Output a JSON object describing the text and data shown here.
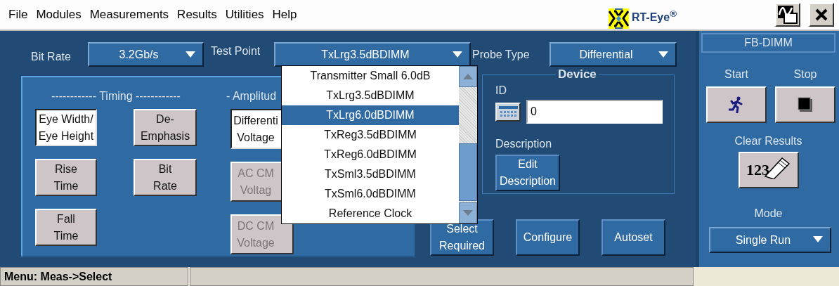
{
  "menu": [
    {
      "label": "File"
    },
    {
      "label": "Modules"
    },
    {
      "label": "Measurements"
    },
    {
      "label": "Results"
    },
    {
      "label": "Utilities"
    },
    {
      "label": "Help"
    }
  ],
  "app_title": "RT-Eye$^{®}$",
  "settings": [
    {
      "label": "Bit Rate",
      "value": "3.2Gb/s"
    },
    {
      "label": "Test Point",
      "value": "TxLrg3.5dBDIMM",
      "expanded": true
    },
    {
      "label": "Probe Type",
      "value": "Differential"
    }
  ],
  "test_point_list": [
    {
      "label": "Transmitter Small 6.0dB",
      "selected": false
    },
    {
      "label": "TxLrg3.5dBDIMM",
      "selected": false
    },
    {
      "label": "TxLrg6.0dBDIMM",
      "selected": true
    },
    {
      "label": "TxReg3.5dBDIMM",
      "selected": false
    },
    {
      "label": "TxReg6.0dBDIMM",
      "selected": false
    },
    {
      "label": "TxSml3.5dBDIMM",
      "selected": false
    },
    {
      "label": "TxSml6.0dBDIMM",
      "selected": false
    },
    {
      "label": "Reference Clock",
      "selected": false
    }
  ],
  "measurements": {
    "timing_header": "------------ Timing ------------",
    "amplitude_header": "- Amplitud",
    "timing_buttons": [
      {
        "lines": [
          "Eye Width/",
          "Eye Height"
        ],
        "selected": true,
        "disabled": false
      },
      {
        "lines": [
          "De-",
          "Emphasis"
        ],
        "selected": false,
        "disabled": false
      },
      {
        "lines": [
          "Rise",
          "Time"
        ],
        "selected": false,
        "disabled": false
      },
      {
        "lines": [
          "Bit",
          "Rate"
        ],
        "selected": false,
        "disabled": false
      },
      {
        "lines": [
          "Fall",
          "Time"
        ],
        "selected": false,
        "disabled": false
      }
    ],
    "amplitude_buttons": [
      {
        "lines": [
          "Differenti",
          "Voltage"
        ],
        "selected": true,
        "disabled": false
      },
      {
        "lines": [
          "AC CM",
          "Voltag"
        ],
        "selected": false,
        "disabled": true
      },
      {
        "lines": [
          "DC CM",
          "Voltage"
        ],
        "selected": false,
        "disabled": true
      }
    ]
  },
  "device": {
    "title": "Device",
    "id_label": "ID",
    "id_value": "0",
    "description_label": "Description",
    "edit_button": [
      "Edit",
      "Description"
    ]
  },
  "actions": [
    {
      "lines": [
        "Select",
        "Required"
      ]
    },
    {
      "lines": [
        "Configure"
      ]
    },
    {
      "lines": [
        "Autoset"
      ]
    }
  ],
  "side_panel": {
    "module": "FB-DIMM",
    "start_label": "Start",
    "stop_label": "Stop",
    "clear_label": "Clear Results",
    "clear_icon_text": "123",
    "mode_label": "Mode",
    "mode_value": "Single Run"
  },
  "status_bar": [
    "Menu: Meas->Select"
  ]
}
